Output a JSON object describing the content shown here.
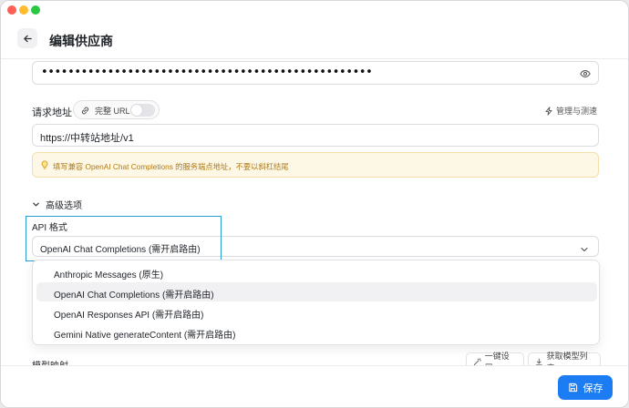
{
  "window": {
    "colors": {
      "close": "#fe5f57",
      "minimize": "#febc2e",
      "zoom": "#28c840"
    }
  },
  "header": {
    "back_icon": "arrow-left-icon",
    "title": "编辑供应商"
  },
  "api_key": {
    "masked_value": "••••••••••••••••••••••••••••••••••••••••••••••••••",
    "toggle_icon": "eye-icon"
  },
  "request_url": {
    "label": "请求地址",
    "full_url_toggle": {
      "label": "完整 URL",
      "icon": "link-icon",
      "on": false
    },
    "manage_label": "管理与测速",
    "manage_icon": "lightning-icon",
    "value": "https://中转站地址/v1"
  },
  "hint": {
    "icon": "lightbulb-icon",
    "text": "填写兼容 OpenAI Chat Completions 的服务端点地址，不要以斜杠结尾",
    "color": "#b07a14"
  },
  "advanced": {
    "label": "高级选项",
    "icon": "chevron-down-icon"
  },
  "api_format": {
    "label": "API 格式",
    "selected": "OpenAI Chat Completions (需开启路由)",
    "options": [
      "Anthropic Messages (原生)",
      "OpenAI Chat Completions (需开启路由)",
      "OpenAI Responses API (需开启路由)",
      "Gemini Native generateContent (需开启路由)"
    ],
    "selected_index": 1,
    "highlight_color": "#2a9bd7"
  },
  "model_mapping": {
    "label": "模型映射",
    "one_click_label": "一键设置",
    "one_click_icon": "wand-icon",
    "fetch_label": "获取模型列表",
    "fetch_icon": "download-icon"
  },
  "footer": {
    "save_label": "保存",
    "save_icon": "save-icon",
    "accent": "#1b7cf4"
  }
}
